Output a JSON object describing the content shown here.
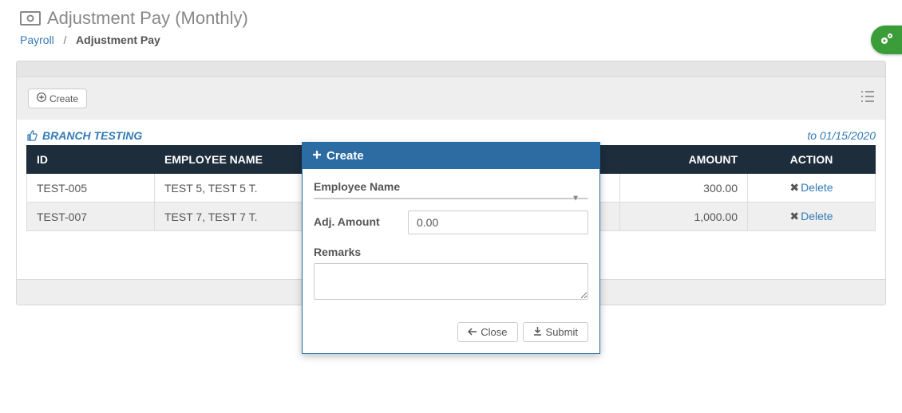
{
  "header": {
    "title": "Adjustment Pay (Monthly)"
  },
  "breadcrumb": {
    "parent": "Payroll",
    "sep": "/",
    "active": "Adjustment Pay"
  },
  "toolbar": {
    "create_label": "Create"
  },
  "info": {
    "branch_label": "BRANCH TESTING",
    "period_label": "to 01/15/2020"
  },
  "table": {
    "headers": {
      "id": "ID",
      "name": "EMPLOYEE NAME",
      "amount": "AMOUNT",
      "action": "ACTION"
    },
    "rows": [
      {
        "id": "TEST-005",
        "name": "TEST 5, TEST 5 T.",
        "amount": "300.00",
        "action": "Delete"
      },
      {
        "id": "TEST-007",
        "name": "TEST 7, TEST 7 T.",
        "amount": "1,000.00",
        "action": "Delete"
      }
    ]
  },
  "modal": {
    "title": "Create",
    "labels": {
      "employee": "Employee Name",
      "amount": "Adj. Amount",
      "remarks": "Remarks"
    },
    "amount_value": "0.00",
    "buttons": {
      "close": "Close",
      "submit": "Submit"
    }
  }
}
